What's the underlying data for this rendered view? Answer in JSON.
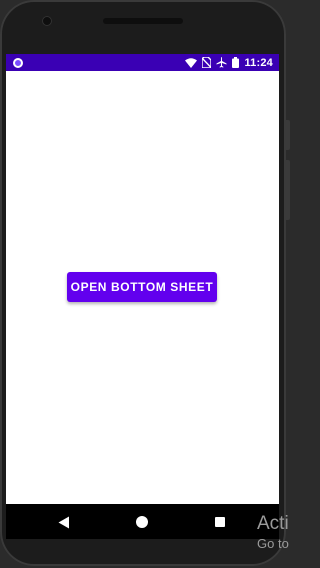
{
  "status_bar": {
    "time": "11:24",
    "background": "#3a00b4",
    "icons": [
      "notification-circle-icon",
      "wifi-icon",
      "no-sim-icon",
      "airplane-icon",
      "battery-icon"
    ]
  },
  "main": {
    "button_label": "OPEN BOTTOM SHEET",
    "button_color": "#6200ee"
  },
  "nav_bar": {
    "icons": [
      "back-icon",
      "home-icon",
      "recents-icon"
    ]
  },
  "watermark": {
    "title": "Acti",
    "subtitle": "Go to"
  }
}
